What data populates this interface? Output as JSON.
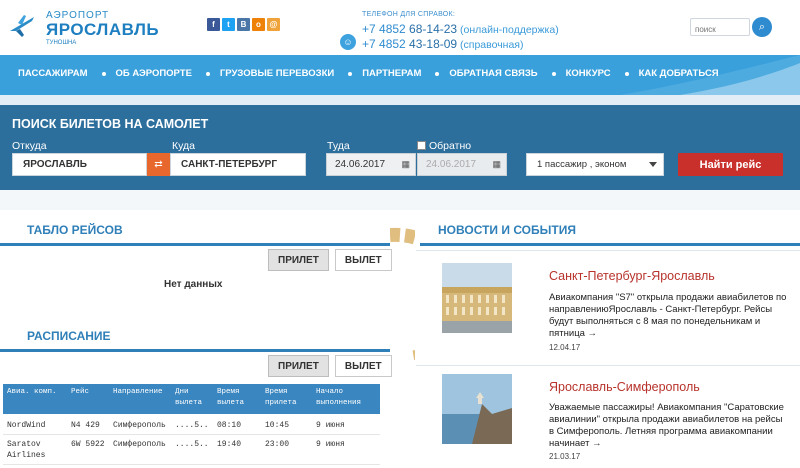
{
  "header": {
    "logo_small": "АЭРОПОРТ",
    "logo_big": "ЯРОСЛАВЛЬ",
    "logo_sub": "ТУНОШНА",
    "social": [
      "f",
      "t",
      "B",
      "o",
      "@"
    ],
    "phones_label": "ТЕЛЕФОН ДЛЯ СПРАВОК:",
    "phone1_num": "+7 4852",
    "phone1_rest": " 68-14-23",
    "phone1_note": " (онлайн-поддержка)",
    "phone2_num": "+7 4852",
    "phone2_rest": " 43-18-09",
    "phone2_note": " (справочная)",
    "search_placeholder": "поиск"
  },
  "nav": {
    "items": [
      "ПАССАЖИРАМ",
      "ОБ АЭРОПОРТЕ",
      "ГРУЗОВЫЕ ПЕРЕВОЗКИ",
      "ПАРТНЕРАМ",
      "ОБРАТНАЯ СВЯЗЬ",
      "КОНКУРС",
      "КАК ДОБРАТЬСЯ"
    ]
  },
  "search_panel": {
    "title": "ПОИСК БИЛЕТОВ НА САМОЛЕТ",
    "from_label": "Откуда",
    "from_value": "ЯРОСЛАВЛЬ",
    "to_label": "Куда",
    "to_value": "САНКТ-ПЕТЕРБУРГ",
    "depart_label": "Туда",
    "depart_value": "24.06.2017",
    "return_label": "Обратно",
    "return_value": "24.06.2017",
    "return_checked": false,
    "passengers": "1 пассажир , эконом",
    "find_button": "Найти рейс"
  },
  "board": {
    "title": "ТАБЛО РЕЙСОВ",
    "tab_arrival": "ПРИЛЕТ",
    "tab_departure": "ВЫЛЕТ",
    "empty": "Нет данных"
  },
  "schedule": {
    "title": "РАСПИСАНИЕ",
    "tab_arrival": "ПРИЛЕТ",
    "tab_departure": "ВЫЛЕТ",
    "columns": [
      [
        "Авиа. комп."
      ],
      [
        "Рейс"
      ],
      [
        "Направление"
      ],
      [
        "Дни",
        "вылета"
      ],
      [
        "Время",
        "вылета"
      ],
      [
        "Время",
        "прилета"
      ],
      [
        "Начало",
        "выполнения"
      ]
    ],
    "rows": [
      [
        "NordWind",
        "N4 429",
        "Симферополь",
        "....5..",
        "08:10",
        "10:45",
        "9 июня"
      ],
      [
        "Saratov Airlines",
        "6W 5922",
        "Симферополь",
        "....5..",
        "19:40",
        "23:00",
        "9 июня"
      ]
    ]
  },
  "news": {
    "title": "НОВОСТИ И СОБЫТИЯ",
    "items": [
      {
        "title": "Санкт-Петербург-Ярославль",
        "text": "Авиакомпания \"S7\" открыла продажи авиабилетов по направлениюЯрославль - Санкт-Петербург. Рейсы будут выполняться с 8 мая по понедельникам и пятница →",
        "date": "12.04.17"
      },
      {
        "title": "Ярославль-Симферополь",
        "text": "Уважаемые пассажиры! Авиакомпания \"Саратовские авиалинии\" открыла продажи авиабилетов на рейсы в Симферополь. Летняя программа авиакомпании начинает →",
        "date": "21.03.17"
      }
    ]
  }
}
